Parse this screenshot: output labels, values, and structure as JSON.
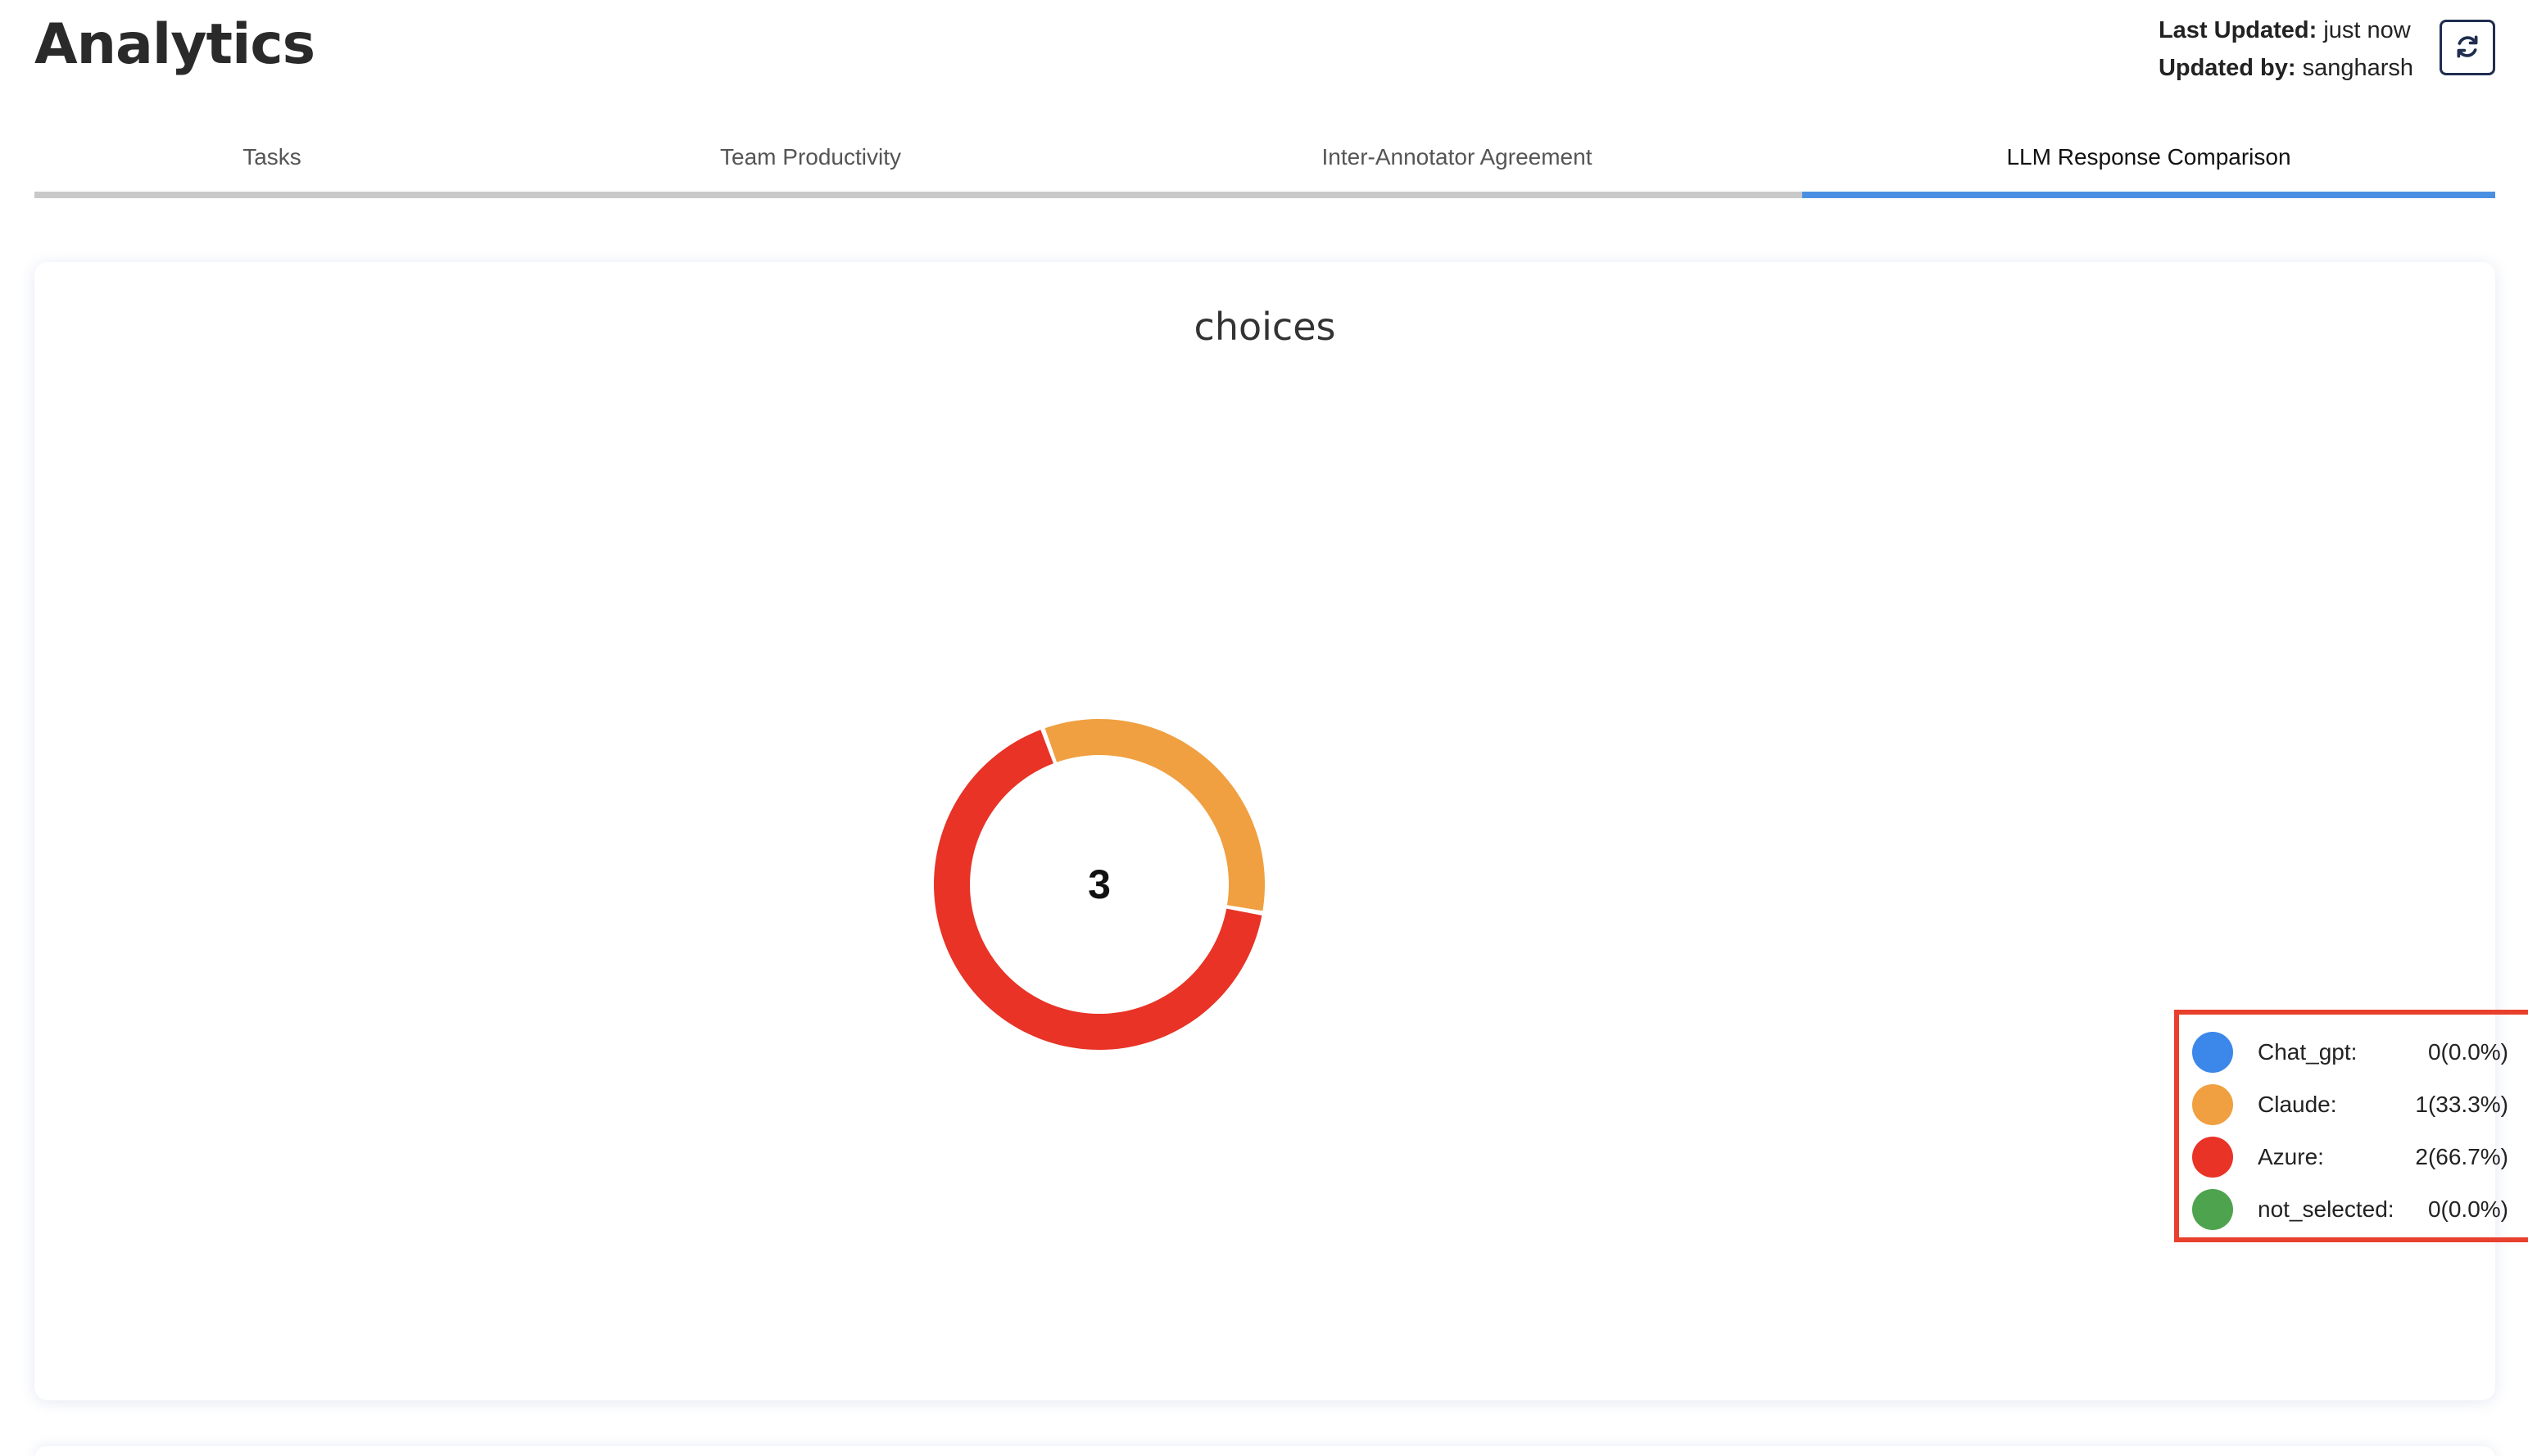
{
  "header": {
    "title": "Analytics",
    "last_updated_label": "Last Updated:",
    "last_updated_value": "just now",
    "updated_by_label": "Updated by:",
    "updated_by_value": "sangharsh",
    "refresh_icon": "refresh-icon"
  },
  "tabs": [
    {
      "label": "Tasks",
      "active": false
    },
    {
      "label": "Team Productivity",
      "active": false
    },
    {
      "label": "Inter-Annotator Agreement",
      "active": false
    },
    {
      "label": "LLM Response Comparison",
      "active": true
    }
  ],
  "colors": {
    "accent": "#4a90e2",
    "chat_gpt": "#3b87ea",
    "claude": "#f0a040",
    "azure": "#e83326",
    "not_selected": "#4ea34e",
    "highlight_box": "#e8402d"
  },
  "chart_data": {
    "type": "pie",
    "variant": "donut",
    "title": "choices",
    "total": 3,
    "categories": [
      "Chat_gpt:",
      "Claude:",
      "Azure:",
      "not_selected:"
    ],
    "values": [
      0,
      1,
      2,
      0
    ],
    "value_labels": [
      "0(0.0%)",
      "1(33.3%)",
      "2(66.7%)",
      "0(0.0%)"
    ],
    "colors": [
      "#3b87ea",
      "#f0a040",
      "#e83326",
      "#4ea34e"
    ],
    "legend_position": "right"
  }
}
